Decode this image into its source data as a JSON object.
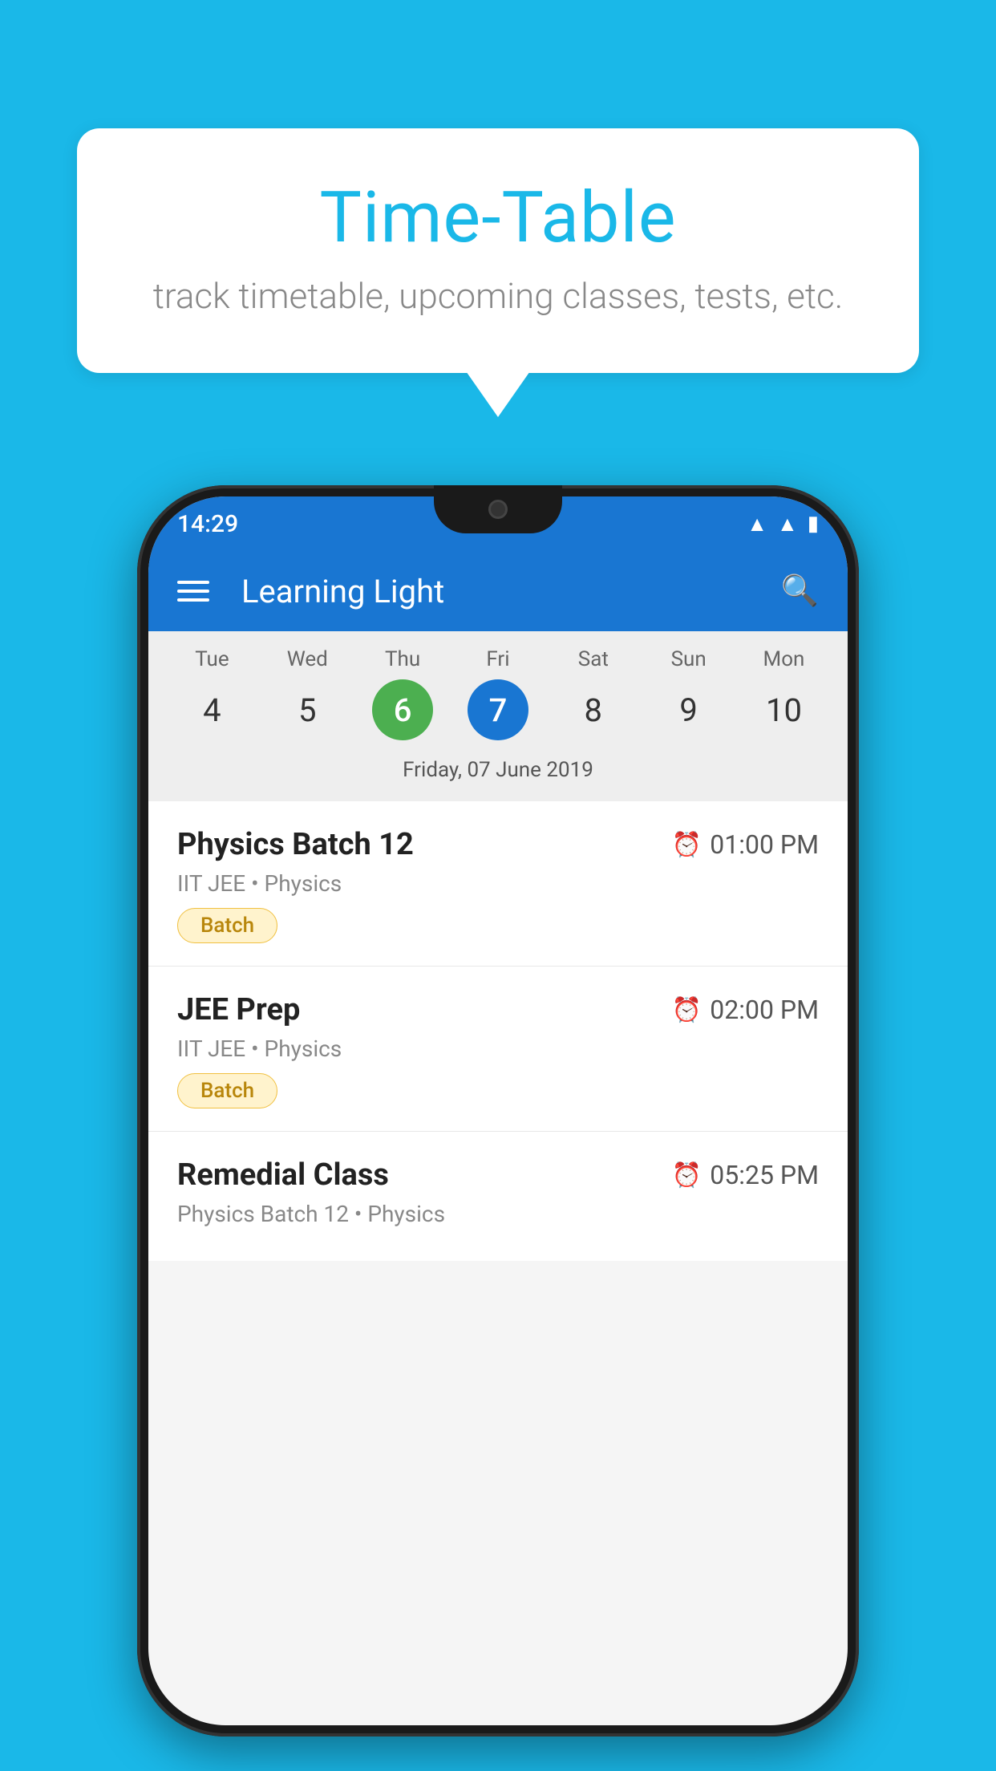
{
  "bubble": {
    "title": "Time-Table",
    "subtitle": "track timetable, upcoming classes, tests, etc."
  },
  "phone": {
    "statusBar": {
      "time": "14:29",
      "icons": [
        "wifi",
        "signal",
        "battery"
      ]
    },
    "appBar": {
      "title": "Learning Light"
    },
    "calendar": {
      "days": [
        {
          "label": "Tue",
          "number": "4",
          "state": "normal"
        },
        {
          "label": "Wed",
          "number": "5",
          "state": "normal"
        },
        {
          "label": "Thu",
          "number": "6",
          "state": "today"
        },
        {
          "label": "Fri",
          "number": "7",
          "state": "selected"
        },
        {
          "label": "Sat",
          "number": "8",
          "state": "normal"
        },
        {
          "label": "Sun",
          "number": "9",
          "state": "normal"
        },
        {
          "label": "Mon",
          "number": "10",
          "state": "normal"
        }
      ],
      "selectedDateLabel": "Friday, 07 June 2019"
    },
    "schedule": [
      {
        "title": "Physics Batch 12",
        "time": "01:00 PM",
        "subtitle": "IIT JEE • Physics",
        "badge": "Batch"
      },
      {
        "title": "JEE Prep",
        "time": "02:00 PM",
        "subtitle": "IIT JEE • Physics",
        "badge": "Batch"
      },
      {
        "title": "Remedial Class",
        "time": "05:25 PM",
        "subtitle": "Physics Batch 12 • Physics",
        "badge": null,
        "partial": true
      }
    ]
  }
}
